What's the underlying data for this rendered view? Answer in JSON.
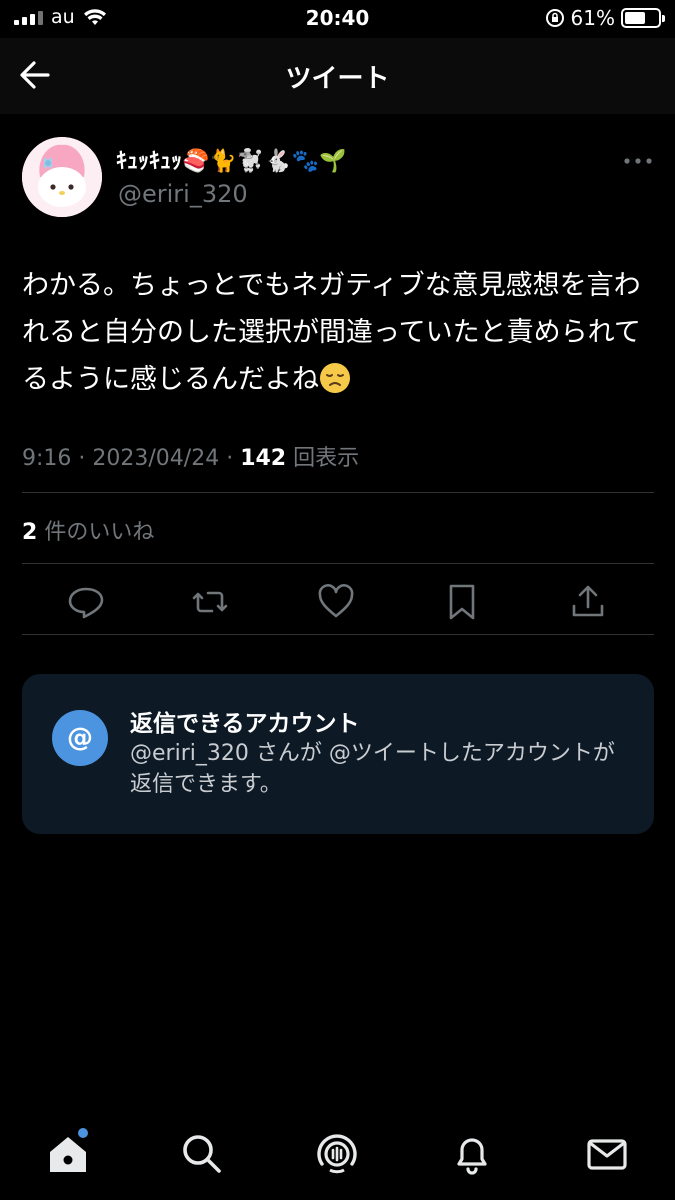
{
  "status_bar": {
    "carrier": "au",
    "time": "20:40",
    "battery": "61%",
    "battery_level": 0.61
  },
  "header": {
    "title": "ツイート"
  },
  "tweet": {
    "display_name": "ｷｭｯｷｭｯ🍣🐈🐩🐇🐾🌱",
    "username": "@eriri_320",
    "text": "わかる。ちょっとでもネガティブな意見感想を言われると自分のした選択が間違っていたと責められてるように感じるんだよね",
    "time": "9:16",
    "date": "2023/04/24",
    "views_count": "142",
    "views_label": "回表示",
    "likes_count": "2",
    "likes_label": "件のいいね"
  },
  "reply_card": {
    "icon_label": "@",
    "title": "返信できるアカウント",
    "description": "@eriri_320 さんが @ツイートしたアカウントが返信できます。"
  },
  "icons": {
    "back": "arrow-left-icon",
    "more": "more-icon",
    "actions": [
      "reply-icon",
      "retweet-icon",
      "like-icon",
      "bookmark-icon",
      "share-icon"
    ],
    "tabs": [
      "home-icon",
      "search-icon",
      "spaces-icon",
      "notifications-icon",
      "messages-icon"
    ]
  },
  "colors": {
    "background": "#000000",
    "accent": "#4d94e0",
    "card": "#0d1a26",
    "muted": "#71767b"
  }
}
